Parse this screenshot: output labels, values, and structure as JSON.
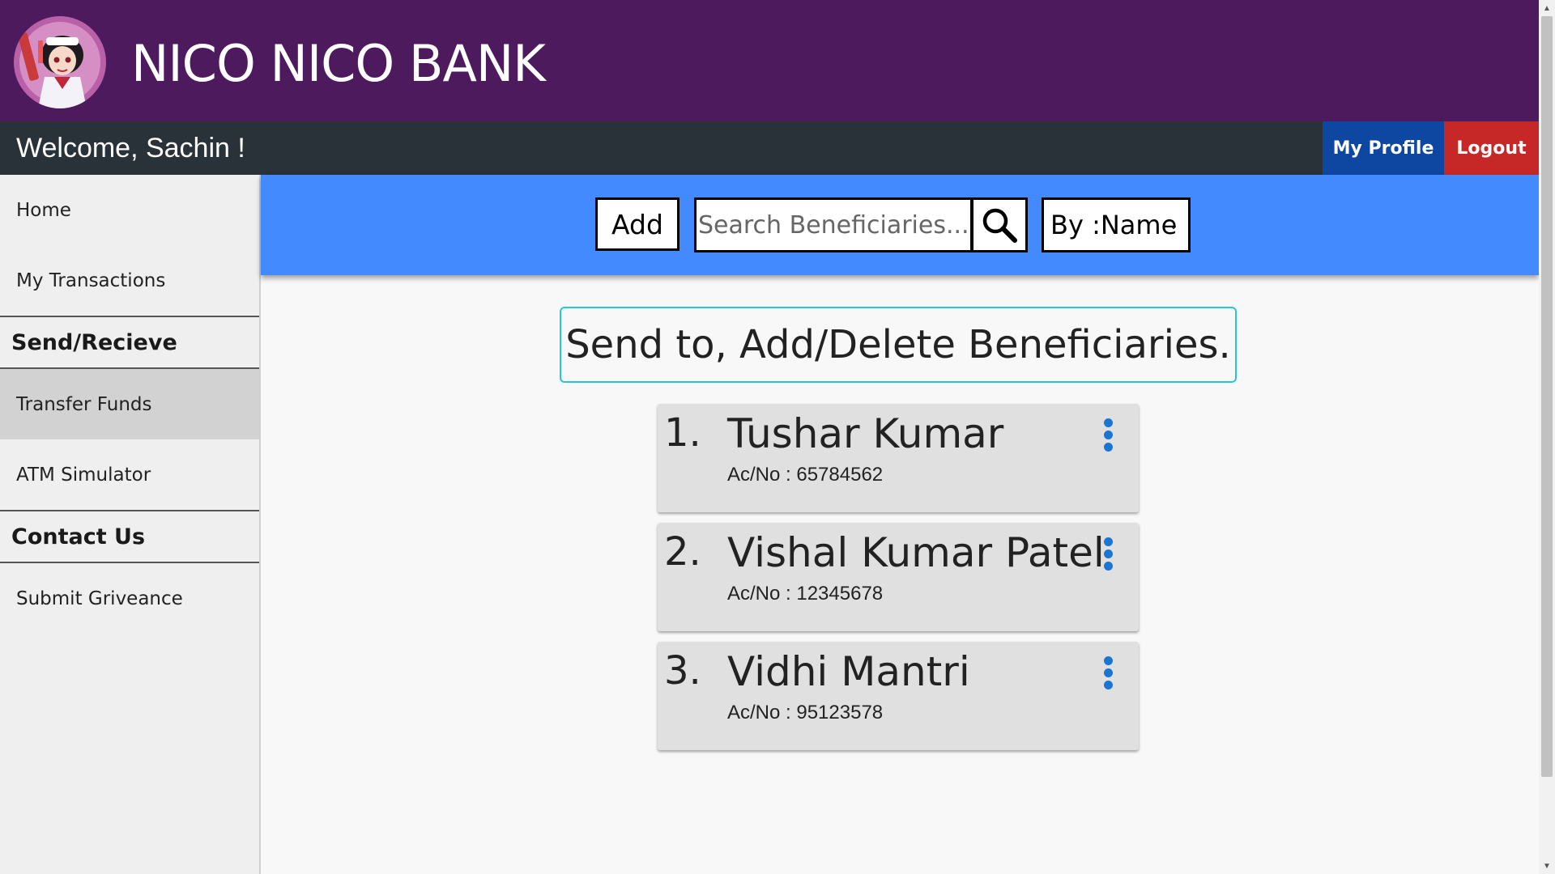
{
  "header": {
    "title": "NICO NICO BANK"
  },
  "topbar": {
    "welcome": "Welcome,  Sachin !",
    "profile_label": "My Profile",
    "logout_label": "Logout"
  },
  "sidebar": {
    "items": [
      {
        "label": "Home"
      },
      {
        "label": "My Transactions"
      },
      {
        "section": "Send/Recieve"
      },
      {
        "label": "Transfer Funds",
        "active": true
      },
      {
        "label": "ATM Simulator"
      },
      {
        "section": "Contact Us"
      },
      {
        "label": "Submit Griveance"
      }
    ]
  },
  "toolbar": {
    "add_label": "Add",
    "search_placeholder": "Search Beneficiaries...",
    "search_value": "",
    "filter_selected": "By :Name"
  },
  "main": {
    "heading": "Send to, Add/Delete Beneficiaries.",
    "beneficiaries": [
      {
        "index": "1.",
        "name": "Tushar Kumar",
        "account": "Ac/No : 65784562"
      },
      {
        "index": "2.",
        "name": "Vishal Kumar Patel",
        "account": "Ac/No : 12345678"
      },
      {
        "index": "3.",
        "name": "Vidhi Mantri",
        "account": "Ac/No : 95123578"
      }
    ]
  },
  "colors": {
    "header_bg": "#4e1a5e",
    "welcome_bar_bg": "#283238",
    "profile_btn": "#0d47a1",
    "logout_btn": "#c62828",
    "toolbar_bg": "#448aff",
    "heading_border": "#26c6da",
    "menu_dots": "#1976d2"
  },
  "icons": {
    "search": "search-icon",
    "card_menu": "more-vert-icon",
    "filter_caret": "chevron-down-icon"
  }
}
